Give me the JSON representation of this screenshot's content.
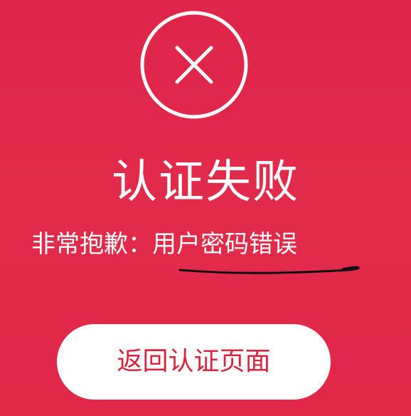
{
  "status": {
    "icon": "close-circle-icon",
    "title": "认证失败",
    "message_prefix": "非常抱歉：",
    "message_detail": "用户密码错误"
  },
  "actions": {
    "back_label": "返回认证页面"
  },
  "colors": {
    "background": "#E3284A",
    "text": "#FFFFFF",
    "button_background": "#FFFFFF",
    "button_text": "#D9243F",
    "annotation": "#111111"
  }
}
